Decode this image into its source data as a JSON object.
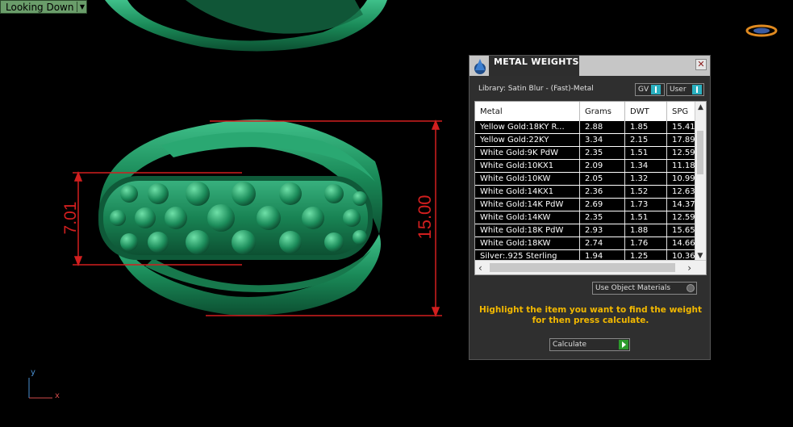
{
  "viewport": {
    "view_label": "Looking Down",
    "dimensions": {
      "height": "7.01",
      "width": "15.00"
    },
    "axis": {
      "y": "y",
      "x": "x"
    }
  },
  "panel": {
    "title": "METAL WEIGHTS",
    "close_glyph": "✕",
    "library": "Library: Satin Blur - (Fast)-Metal",
    "toggles": {
      "gv": "GV",
      "user": "User"
    },
    "columns": [
      "Metal",
      "Grams",
      "DWT",
      "SPG"
    ],
    "rows": [
      [
        "Yellow Gold:18KY R...",
        "2.88",
        "1.85",
        "15.41"
      ],
      [
        "Yellow Gold:22KY",
        "3.34",
        "2.15",
        "17.89"
      ],
      [
        "White Gold:9K PdW",
        "2.35",
        "1.51",
        "12.59"
      ],
      [
        "White Gold:10KX1",
        "2.09",
        "1.34",
        "11.18"
      ],
      [
        "White Gold:10KW",
        "2.05",
        "1.32",
        "10.99"
      ],
      [
        "White Gold:14KX1",
        "2.36",
        "1.52",
        "12.63"
      ],
      [
        "White Gold:14K PdW",
        "2.69",
        "1.73",
        "14.37"
      ],
      [
        "White Gold:14KW",
        "2.35",
        "1.51",
        "12.59"
      ],
      [
        "White Gold:18K PdW",
        "2.93",
        "1.88",
        "15.65"
      ],
      [
        "White Gold:18KW",
        "2.74",
        "1.76",
        "14.66"
      ],
      [
        "Silver:.925 Sterling",
        "1.94",
        "1.25",
        "10.36"
      ]
    ],
    "use_object_materials": "Use Object Materials",
    "hint": "Highlight the item you want to find the weight for then press calculate.",
    "calculate": "Calculate"
  },
  "colors": {
    "ring": "#1e8a5a",
    "dimension": "#d21f1f",
    "hint": "#f2b800",
    "accent": "#2ab0c0"
  },
  "icons": [
    "chevron-down-icon",
    "logo-icon",
    "panel-app-icon",
    "close-icon",
    "toggle-icon",
    "scroll-up-icon",
    "scroll-down-icon",
    "scroll-left-icon",
    "scroll-right-icon",
    "radio-icon",
    "play-icon"
  ]
}
